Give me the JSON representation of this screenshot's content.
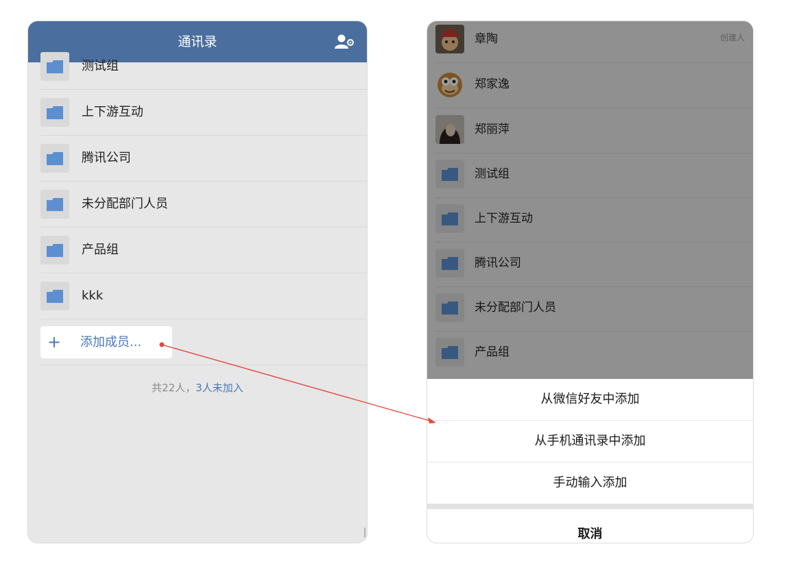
{
  "left_screen": {
    "nav_title": "通讯录",
    "nav_right_icon": "user-settings-icon",
    "groups": [
      "测试组",
      "上下游互动",
      "腾讯公司",
      "未分配部门人员",
      "产品组",
      "kkk"
    ],
    "add_member": {
      "icon": "plus-icon",
      "label": "添加成员..."
    },
    "summary": {
      "total": "共22人，",
      "pending": "3人未加入"
    }
  },
  "right_screen": {
    "members": [
      {
        "name": "章陶",
        "badge": "创建人",
        "avatar": "avatar-red-hat-icon"
      },
      {
        "name": "郑家逸",
        "avatar": "avatar-monkey-icon"
      },
      {
        "name": "郑丽萍",
        "avatar": "avatar-photo-icon"
      }
    ],
    "groups": [
      "测试组",
      "上下游互动",
      "腾讯公司",
      "未分配部门人员",
      "产品组"
    ],
    "action_sheet": {
      "options": [
        "从微信好友中添加",
        "从手机通讯录中添加",
        "手动输入添加"
      ],
      "cancel": "取消"
    }
  },
  "colors": {
    "nav_bar": "#4a6e9e",
    "folder": "#5b8fd0",
    "link": "#4a78b8",
    "arrow": "#e24a3a"
  }
}
